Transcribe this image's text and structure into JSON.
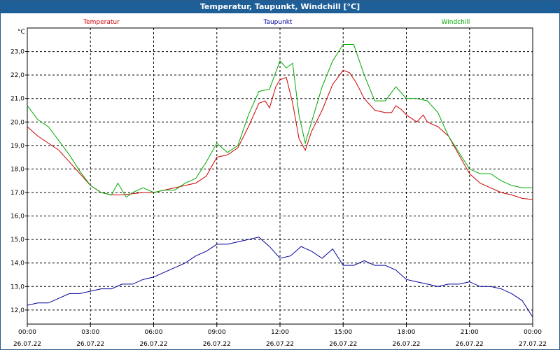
{
  "window": {
    "title": "Temperatur, Taupunkt, Windchill [°C]"
  },
  "chart_data": {
    "type": "line",
    "title": "Temperatur, Taupunkt, Windchill [°C]",
    "ylabel": "°C",
    "ylim": [
      11.4,
      24.0
    ],
    "xlim": [
      0,
      24
    ],
    "grid": true,
    "y_ticks": [
      "12,0",
      "13,0",
      "14,0",
      "15,0",
      "16,0",
      "17,0",
      "18,0",
      "19,0",
      "20,0",
      "21,0",
      "22,0",
      "23,0"
    ],
    "x_ticks": [
      {
        "time": "00:00",
        "date": "26.07.22"
      },
      {
        "time": "03:00",
        "date": "26.07.22"
      },
      {
        "time": "06:00",
        "date": "26.07.22"
      },
      {
        "time": "09:00",
        "date": "26.07.22"
      },
      {
        "time": "12:00",
        "date": "26.07.22"
      },
      {
        "time": "15:00",
        "date": "26.07.22"
      },
      {
        "time": "18:00",
        "date": "26.07.22"
      },
      {
        "time": "21:00",
        "date": "26.07.22"
      },
      {
        "time": "00:00",
        "date": "27.07.22"
      }
    ],
    "series": [
      {
        "name": "Temperatur",
        "color": "#cc0000",
        "points": [
          [
            0,
            19.8
          ],
          [
            0.5,
            19.4
          ],
          [
            1,
            19.1
          ],
          [
            1.5,
            18.8
          ],
          [
            2,
            18.3
          ],
          [
            2.5,
            17.8
          ],
          [
            3,
            17.3
          ],
          [
            3.5,
            17.0
          ],
          [
            4,
            16.9
          ],
          [
            4.5,
            16.9
          ],
          [
            5,
            16.95
          ],
          [
            5.5,
            17.0
          ],
          [
            6,
            17.0
          ],
          [
            6.5,
            17.1
          ],
          [
            7,
            17.2
          ],
          [
            7.5,
            17.3
          ],
          [
            8,
            17.4
          ],
          [
            8.5,
            17.7
          ],
          [
            9,
            18.5
          ],
          [
            9.5,
            18.6
          ],
          [
            10,
            18.9
          ],
          [
            10.5,
            19.8
          ],
          [
            11,
            20.8
          ],
          [
            11.3,
            20.9
          ],
          [
            11.5,
            20.6
          ],
          [
            11.8,
            21.5
          ],
          [
            12,
            21.8
          ],
          [
            12.3,
            21.9
          ],
          [
            12.6,
            20.8
          ],
          [
            12.9,
            19.3
          ],
          [
            13.2,
            18.8
          ],
          [
            13.5,
            19.6
          ],
          [
            14,
            20.5
          ],
          [
            14.5,
            21.6
          ],
          [
            15,
            22.2
          ],
          [
            15.3,
            22.1
          ],
          [
            15.6,
            21.7
          ],
          [
            16,
            21.0
          ],
          [
            16.5,
            20.5
          ],
          [
            17,
            20.4
          ],
          [
            17.3,
            20.4
          ],
          [
            17.5,
            20.7
          ],
          [
            17.8,
            20.5
          ],
          [
            18,
            20.3
          ],
          [
            18.5,
            20.0
          ],
          [
            18.8,
            20.3
          ],
          [
            19,
            20.0
          ],
          [
            19.5,
            19.8
          ],
          [
            20,
            19.4
          ],
          [
            20.5,
            18.6
          ],
          [
            21,
            17.8
          ],
          [
            21.5,
            17.4
          ],
          [
            22,
            17.2
          ],
          [
            22.5,
            17.0
          ],
          [
            23,
            16.9
          ],
          [
            23.5,
            16.75
          ],
          [
            24,
            16.7
          ]
        ]
      },
      {
        "name": "Taupunkt",
        "color": "#000099",
        "points": [
          [
            0,
            12.2
          ],
          [
            0.5,
            12.3
          ],
          [
            1,
            12.3
          ],
          [
            1.5,
            12.5
          ],
          [
            2,
            12.7
          ],
          [
            2.5,
            12.7
          ],
          [
            3,
            12.8
          ],
          [
            3.5,
            12.9
          ],
          [
            4,
            12.9
          ],
          [
            4.5,
            13.1
          ],
          [
            5,
            13.1
          ],
          [
            5.5,
            13.3
          ],
          [
            6,
            13.4
          ],
          [
            6.5,
            13.6
          ],
          [
            7,
            13.8
          ],
          [
            7.5,
            14.0
          ],
          [
            8,
            14.3
          ],
          [
            8.5,
            14.5
          ],
          [
            9,
            14.8
          ],
          [
            9.5,
            14.8
          ],
          [
            10,
            14.9
          ],
          [
            10.5,
            15.0
          ],
          [
            11,
            15.1
          ],
          [
            11.5,
            14.7
          ],
          [
            12,
            14.2
          ],
          [
            12.5,
            14.3
          ],
          [
            13,
            14.7
          ],
          [
            13.5,
            14.5
          ],
          [
            14,
            14.2
          ],
          [
            14.5,
            14.6
          ],
          [
            15,
            13.9
          ],
          [
            15.5,
            13.9
          ],
          [
            16,
            14.1
          ],
          [
            16.5,
            13.9
          ],
          [
            17,
            13.9
          ],
          [
            17.5,
            13.7
          ],
          [
            18,
            13.3
          ],
          [
            18.5,
            13.2
          ],
          [
            19,
            13.1
          ],
          [
            19.5,
            13.0
          ],
          [
            20,
            13.1
          ],
          [
            20.5,
            13.1
          ],
          [
            21,
            13.2
          ],
          [
            21.5,
            13.0
          ],
          [
            22,
            13.0
          ],
          [
            22.5,
            12.9
          ],
          [
            23,
            12.7
          ],
          [
            23.5,
            12.4
          ],
          [
            24,
            11.7
          ]
        ]
      },
      {
        "name": "Windchill",
        "color": "#00aa00",
        "points": [
          [
            0,
            20.7
          ],
          [
            0.5,
            20.1
          ],
          [
            1,
            19.8
          ],
          [
            1.5,
            19.2
          ],
          [
            2,
            18.6
          ],
          [
            2.5,
            17.9
          ],
          [
            3,
            17.3
          ],
          [
            3.5,
            17.0
          ],
          [
            4,
            16.9
          ],
          [
            4.3,
            17.4
          ],
          [
            4.7,
            16.8
          ],
          [
            5,
            17.0
          ],
          [
            5.5,
            17.2
          ],
          [
            6,
            17.0
          ],
          [
            6.5,
            17.1
          ],
          [
            7,
            17.1
          ],
          [
            7.5,
            17.4
          ],
          [
            8,
            17.6
          ],
          [
            8.5,
            18.3
          ],
          [
            9,
            19.1
          ],
          [
            9.5,
            18.7
          ],
          [
            10,
            19.0
          ],
          [
            10.5,
            20.3
          ],
          [
            11,
            21.3
          ],
          [
            11.5,
            21.4
          ],
          [
            12,
            22.6
          ],
          [
            12.3,
            22.3
          ],
          [
            12.6,
            22.5
          ],
          [
            12.9,
            20.3
          ],
          [
            13.2,
            19.1
          ],
          [
            13.5,
            20.0
          ],
          [
            14,
            21.5
          ],
          [
            14.5,
            22.6
          ],
          [
            15,
            23.3
          ],
          [
            15.5,
            23.3
          ],
          [
            16,
            22.0
          ],
          [
            16.5,
            20.9
          ],
          [
            17,
            20.9
          ],
          [
            17.5,
            21.5
          ],
          [
            18,
            21.0
          ],
          [
            18.5,
            21.0
          ],
          [
            19,
            20.9
          ],
          [
            19.5,
            20.4
          ],
          [
            20,
            19.4
          ],
          [
            20.5,
            18.7
          ],
          [
            21,
            18.0
          ],
          [
            21.5,
            17.8
          ],
          [
            22,
            17.8
          ],
          [
            22.5,
            17.5
          ],
          [
            23,
            17.3
          ],
          [
            23.5,
            17.2
          ],
          [
            24,
            17.2
          ]
        ]
      }
    ]
  }
}
